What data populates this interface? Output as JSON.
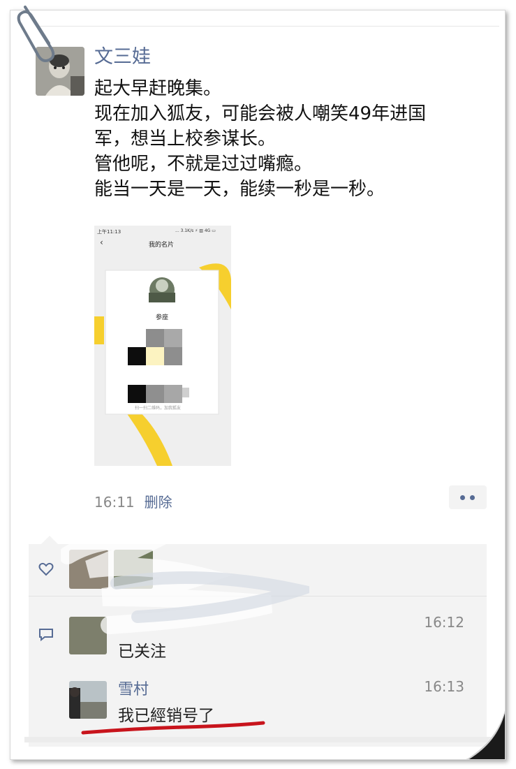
{
  "post": {
    "author": "文三娃",
    "lines": [
      "起大早赶晚集。",
      "现在加入狐友，可能会被人嘲笑49年进国",
      "军，想当上校参谋长。",
      "管他呢，不就是过过嘴瘾。",
      "能当一天是一天，能续一秒是一秒。"
    ],
    "time": "16:11",
    "delete_label": "删除"
  },
  "shared_card": {
    "status_left": "上午11:13",
    "status_right": "... 3.1K/s ⚡ ▥ 4G  ▭",
    "title": "我的名片",
    "name": "参座",
    "hint": "扫一扫二维码，加我狐友"
  },
  "comments": [
    {
      "name": "",
      "time": "16:12",
      "text": "已关注"
    },
    {
      "name": "雪村",
      "time": "16:13",
      "text": "我已經销号了"
    }
  ],
  "colors": {
    "link": "#566b94",
    "accent_yellow": "#f6cf2e",
    "underline_red": "#c8141c"
  }
}
